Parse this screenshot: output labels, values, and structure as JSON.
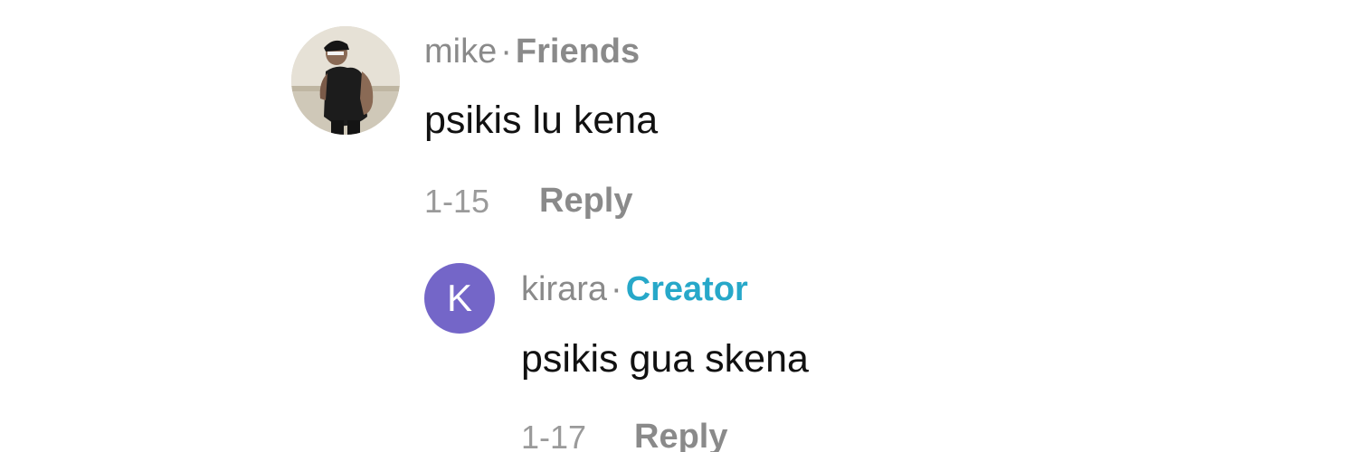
{
  "comments": [
    {
      "author": "mike",
      "separator": "·",
      "tag": "Friends",
      "text": "psikis lu kena",
      "date": "1-15",
      "reply_label": "Reply"
    },
    {
      "author": "kirara",
      "separator": "·",
      "tag": "Creator",
      "avatar_letter": "K",
      "avatar_color": "#7466c8",
      "text": "psikis gua skena",
      "date": "1-17",
      "reply_label": "Reply"
    }
  ],
  "colors": {
    "creator_tag": "#27a8c9",
    "muted": "#8a8a8a",
    "body": "#111111"
  }
}
